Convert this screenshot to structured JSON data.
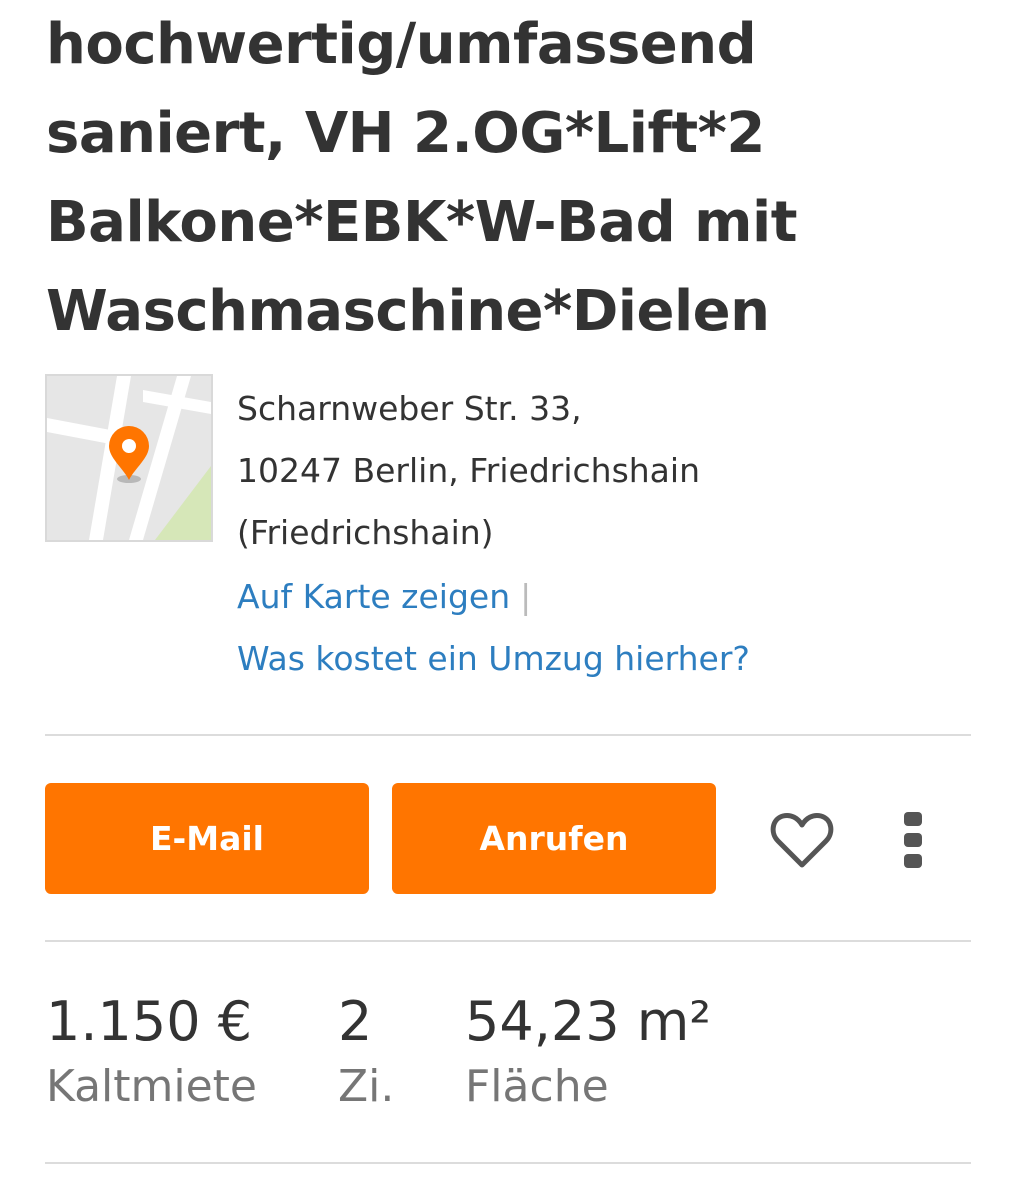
{
  "listing": {
    "title_lines": [
      "hochwertig/umfassend",
      "saniert, VH 2.OG*Lift*2",
      "Balkone*EBK*W-Bad mit",
      "Waschmaschine*Dielen"
    ]
  },
  "location": {
    "map_icon": "map-pin-icon",
    "address_lines": [
      "Scharnweber Str. 33,",
      "10247 Berlin, Friedrichshain",
      "(Friedrichshain)"
    ],
    "show_on_map_label": "Auf Karte zeigen",
    "separator": "|",
    "moving_cost_label": "Was kostet ein Umzug hierher?"
  },
  "actions": {
    "email_label": "E-Mail",
    "call_label": "Anrufen",
    "favorite_icon": "heart-icon",
    "more_icon": "more-vertical-icon"
  },
  "key_facts": [
    {
      "value": "1.150 €",
      "label": "Kaltmiete"
    },
    {
      "value": "2",
      "label": "Zi."
    },
    {
      "value": "54,23 m²",
      "label": "Fläche"
    }
  ],
  "colors": {
    "accent": "#ff7500",
    "link": "#2d7ec0",
    "text": "#333333",
    "muted": "#767676",
    "divider": "#dcdcdc"
  }
}
